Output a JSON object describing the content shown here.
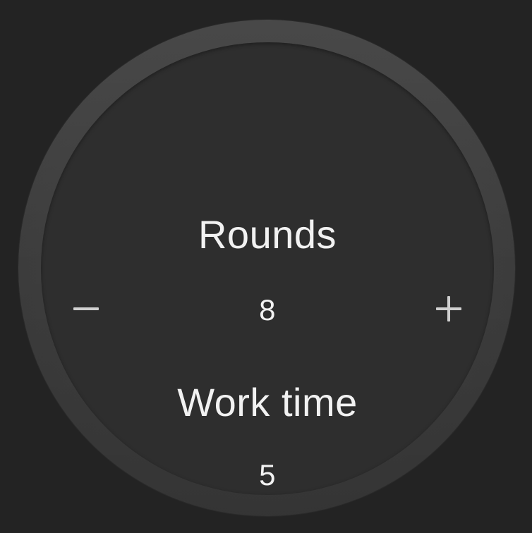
{
  "rounds": {
    "title": "Rounds",
    "value": "8",
    "decrease_icon": "minus-icon",
    "increase_icon": "plus-icon"
  },
  "work_time": {
    "title": "Work time",
    "value": "5"
  },
  "colors": {
    "background": "#232323",
    "bezel": "#3b3b3b",
    "face": "#2e2e2e",
    "text": "#f2f2f2",
    "icon": "#d0d0d0"
  }
}
